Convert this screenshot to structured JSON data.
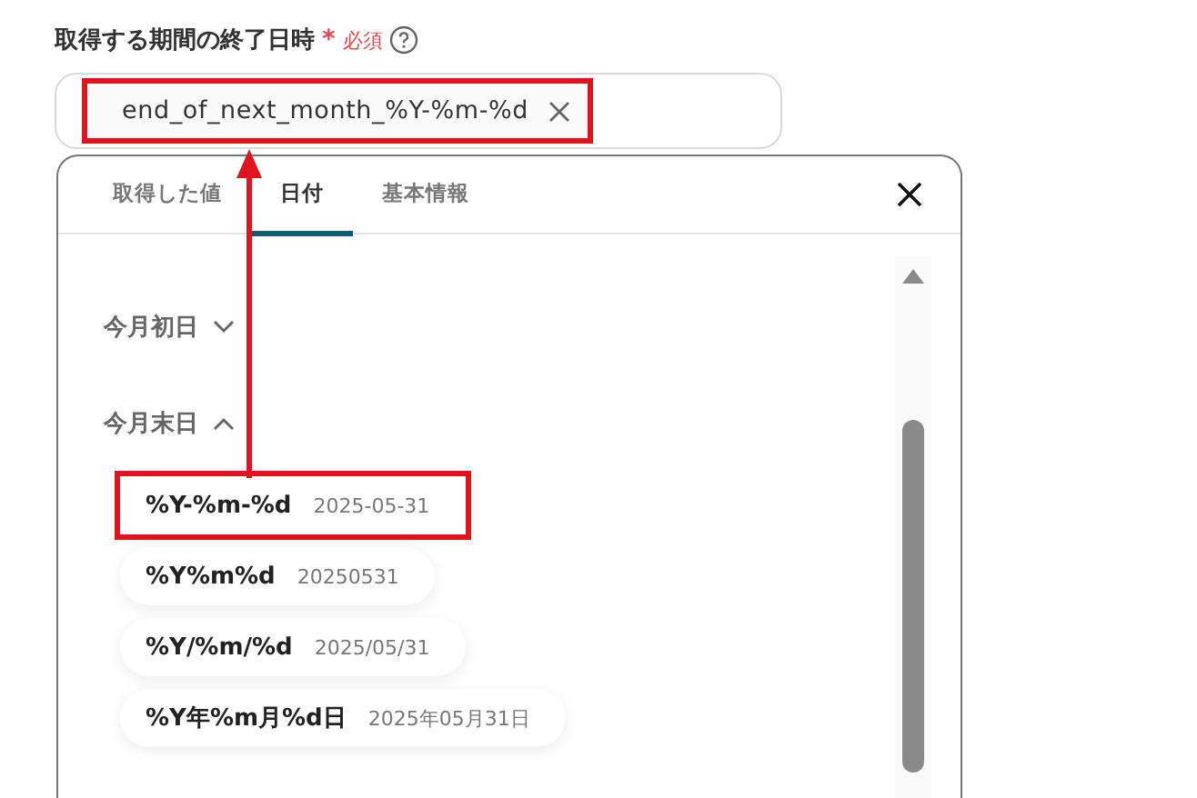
{
  "field": {
    "label": "取得する期間の終了日時",
    "required_mark": "*",
    "required_text": "必須",
    "chip": {
      "value": "end_of_next_month_%Y-%m-%d",
      "annotated": true
    }
  },
  "tabs": [
    {
      "label": "取得した値",
      "selected": false
    },
    {
      "label": "日付",
      "selected": true
    },
    {
      "label": "基本情報",
      "selected": false
    }
  ],
  "groups": [
    {
      "label": "今月初日",
      "expanded": false
    },
    {
      "label": "今月末日",
      "expanded": true,
      "items": [
        {
          "format": "%Y-%m-%d",
          "example": "2025-05-31",
          "annotated": true
        },
        {
          "format": "%Y%m%d",
          "example": "20250531",
          "annotated": false
        },
        {
          "format": "%Y/%m/%d",
          "example": "2025/05/31",
          "annotated": false
        },
        {
          "format": "%Y年%m月%d日",
          "example": "2025年05月31日",
          "annotated": false
        }
      ]
    }
  ]
}
